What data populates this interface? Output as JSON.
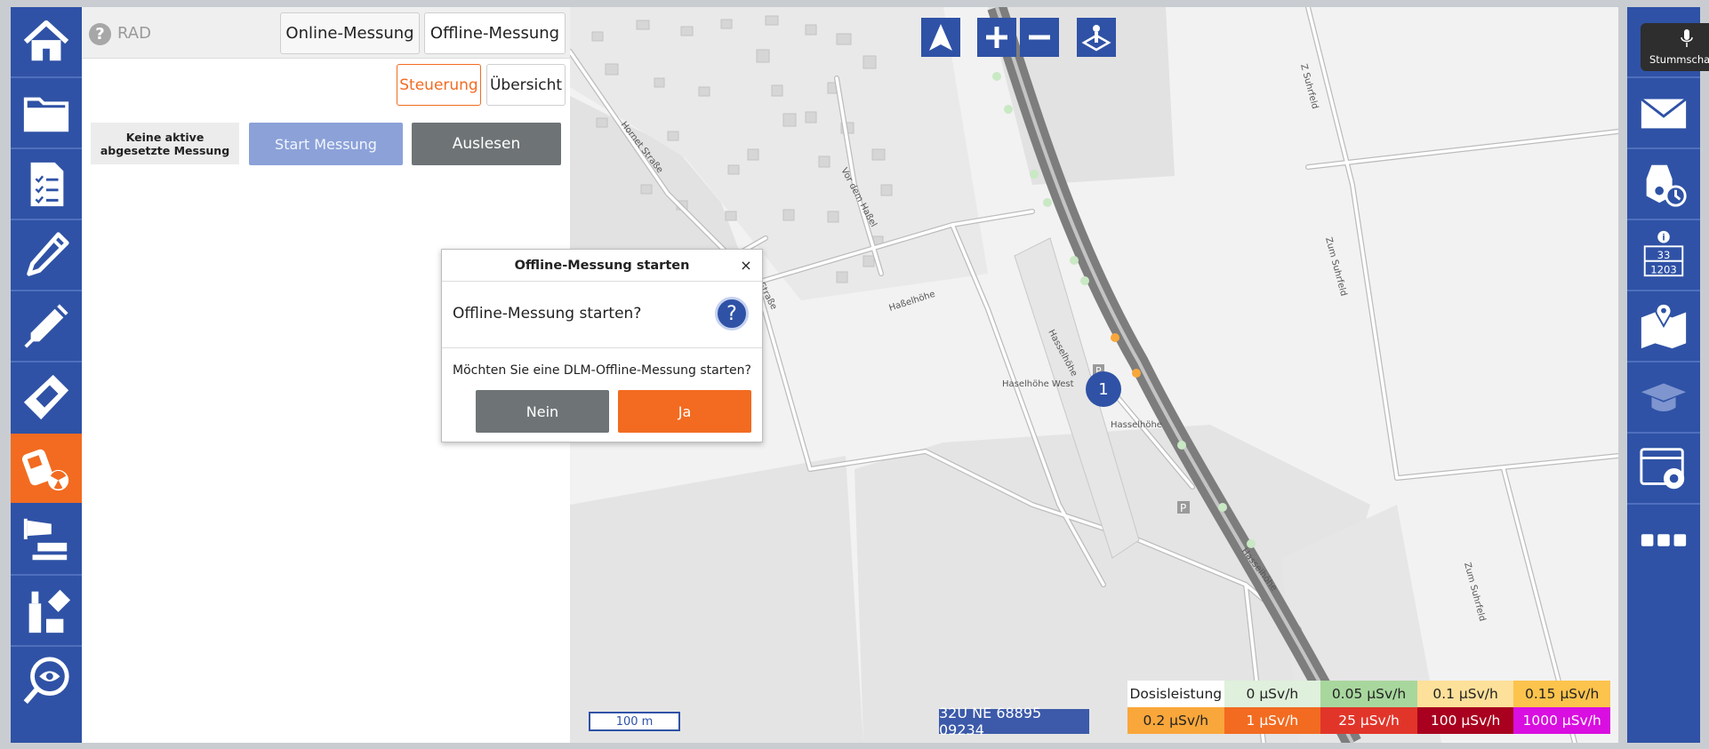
{
  "panel": {
    "help_glyph": "?",
    "module": "RAD",
    "tabs": [
      "Online-Messung",
      "Offline-Messung"
    ],
    "subtabs": [
      "Steuerung",
      "Übersicht"
    ],
    "status": "Keine aktive abgesetzte Messung",
    "start_button": "Start Messung",
    "read_button": "Auslesen"
  },
  "dialog": {
    "title": "Offline-Messung starten",
    "close_glyph": "×",
    "question": "Offline-Messung starten?",
    "question_glyph": "?",
    "message": "Möchten Sie eine DLM-Offline-Messung starten?",
    "no_label": "Nein",
    "yes_label": "Ja"
  },
  "map": {
    "scale": "100 m",
    "coordinates": "32U NE 68895 09234",
    "marker_label": "1",
    "street_labels": [
      "Hornet Straße",
      "Vor dem Haßel",
      "Haßelhöhe",
      "Hasselhöhe",
      "Haselhöhe West",
      "Hasselhöhe",
      "Zum Suhrfeld",
      "Zum Suhrfeld",
      "Z Suhrfeld",
      "Straße",
      "Hasselhöhe"
    ],
    "legend": {
      "title": "Dosisleistung",
      "items": [
        {
          "label": "0 µSv/h",
          "color": "#dff0dc"
        },
        {
          "label": "0.05 µSv/h",
          "color": "#a8d79e"
        },
        {
          "label": "0.1 µSv/h",
          "color": "#fde09a"
        },
        {
          "label": "0.15 µSv/h",
          "color": "#fcc34d"
        },
        {
          "label": "0.2 µSv/h",
          "color": "#f9a73b"
        },
        {
          "label": "1 µSv/h",
          "color": "#f26b21"
        },
        {
          "label": "25 µSv/h",
          "color": "#e2352a"
        },
        {
          "label": "100 µSv/h",
          "color": "#a8001e"
        },
        {
          "label": "1000 µSv/h",
          "color": "#d90ee0"
        }
      ]
    }
  },
  "tooltip": "Stummschal",
  "right_nav": {
    "info_numbers": [
      "33",
      "1203"
    ]
  },
  "colors": {
    "nav_blue": "#2f52a6",
    "accent_orange": "#f26b21",
    "gray_button": "#6e7476"
  },
  "icons": {
    "left_nav": [
      "home-icon",
      "folder-icon",
      "checklist-icon",
      "pen-icon",
      "syringe-icon",
      "device-icon",
      "radiation-meter-icon",
      "windsock-icon",
      "chemicals-icon",
      "eye-search-icon"
    ],
    "right_nav": [
      "chat-icon",
      "mail-icon",
      "gas-mask-clock-icon",
      "info-grid-icon",
      "map-pin-icon",
      "graduation-cap-icon",
      "settings-window-icon",
      "more-icon"
    ]
  }
}
